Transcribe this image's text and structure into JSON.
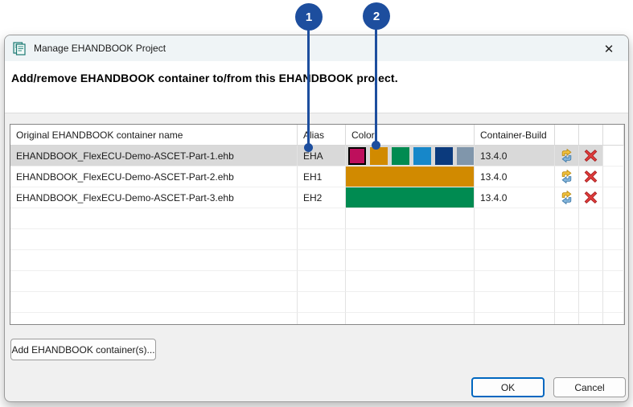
{
  "callouts": [
    {
      "number": "1",
      "target": "alias-column"
    },
    {
      "number": "2",
      "target": "color-swatch-orange"
    }
  ],
  "dialog": {
    "title": "Manage EHANDBOOK Project",
    "close_glyph": "✕",
    "heading": "Add/remove EHANDBOOK container to/from this EHANDBOOK project."
  },
  "table": {
    "headers": {
      "name": "Original EHANDBOOK container name",
      "alias": "Alias",
      "color": "Color",
      "build": "Container-Build"
    },
    "rows": [
      {
        "name": "EHANDBOOK_FlexECU-Demo-ASCET-Part-1.ehb",
        "alias": "EHA",
        "build": "13.4.0",
        "selected": true,
        "palette": [
          "#be0f5c",
          "#d18a00",
          "#008b51",
          "#1787c9",
          "#0b3a7d",
          "#8096ab"
        ],
        "selected_color": "#be0f5c"
      },
      {
        "name": "EHANDBOOK_FlexECU-Demo-ASCET-Part-2.ehb",
        "alias": "EH1",
        "build": "13.4.0",
        "color": "#d18a00"
      },
      {
        "name": "EHANDBOOK_FlexECU-Demo-ASCET-Part-3.ehb",
        "alias": "EH2",
        "build": "13.4.0",
        "color": "#008b51"
      }
    ]
  },
  "buttons": {
    "add": "Add EHANDBOOK container(s)...",
    "ok": "OK",
    "cancel": "Cancel"
  },
  "colors": {
    "callout_blue": "#1d4e9e",
    "selected_row": "#d9d9d9",
    "ok_border": "#0067c0"
  }
}
